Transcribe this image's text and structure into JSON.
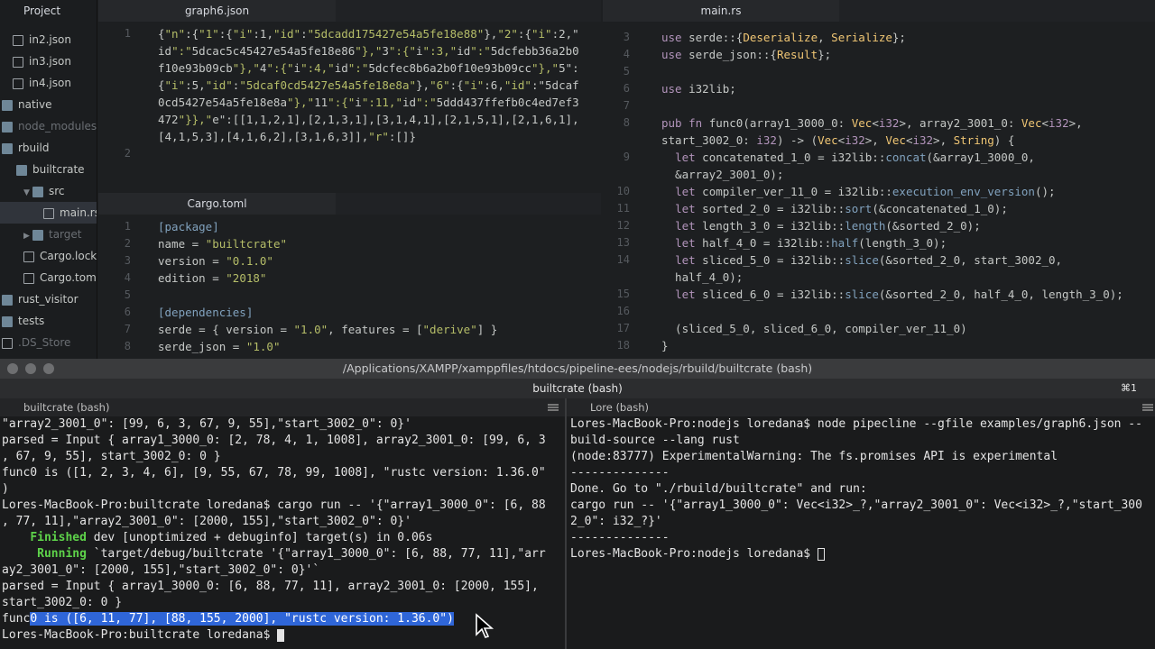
{
  "sidebar": {
    "header": "Project",
    "items": [
      {
        "label": "in2.json",
        "type": "file"
      },
      {
        "label": "in3.json",
        "type": "file"
      },
      {
        "label": "in4.json",
        "type": "file"
      },
      {
        "label": "native",
        "type": "folder"
      },
      {
        "label": "node_modules",
        "type": "folder-dim"
      },
      {
        "label": "rbuild",
        "type": "folder"
      },
      {
        "label": "builtcrate",
        "type": "folder"
      },
      {
        "label": "src",
        "type": "folder-open"
      },
      {
        "label": "main.rs",
        "type": "file-selected"
      },
      {
        "label": "target",
        "type": "folder-dim"
      },
      {
        "label": "Cargo.lock",
        "type": "file"
      },
      {
        "label": "Cargo.toml",
        "type": "file"
      },
      {
        "label": "rust_visitor",
        "type": "folder"
      },
      {
        "label": "tests",
        "type": "folder"
      },
      {
        "label": ".DS_Store",
        "type": "file-dim"
      }
    ]
  },
  "panes": {
    "graph": {
      "tab": "graph6.json",
      "gutter": [
        "1",
        "",
        "",
        "",
        "",
        "",
        "",
        "2"
      ],
      "lines": [
        "{\"n\":{\"1\":{\"i\":1,\"id\":\"5dcadd175427e54a5fe18e88\"},\"2\":{\"i\":2,\"",
        "id\":\"5dcac5c45427e54a5fe18e86\"},\"3\":{\"i\":3,\"id\":\"5dcfebb36a2b0",
        "f10e93b09cb\"},\"4\":{\"i\":4,\"id\":\"5dcfec8b6a2b0f10e93b09cc\"},\"5\":",
        "{\"i\":5,\"id\":\"5dcaf0cd5427e54a5fe18e8a\"},\"6\":{\"i\":6,\"id\":\"5dcaf",
        "0cd5427e54a5fe18e8a\"},\"11\":{\"i\":11,\"id\":\"5ddd437ffefb0c4ed7ef3",
        "472\"}},\"e\":[[1,1,2,1],[2,1,3,1],[3,1,4,1],[2,1,5,1],[2,1,6,1],",
        "[4,1,5,3],[4,1,6,2],[3,1,6,3]],\"r\":[]}",
        ""
      ]
    },
    "cargo": {
      "tab": "Cargo.toml",
      "gutter": [
        "1",
        "2",
        "3",
        "4",
        "5",
        "6",
        "7",
        "8"
      ],
      "lines": [
        "[package]",
        "name = \"builtcrate\"",
        "version = \"0.1.0\"",
        "edition = \"2018\"",
        "",
        "[dependencies]",
        "serde = { version = \"1.0\", features = [\"derive\"] }",
        "serde_json = \"1.0\""
      ]
    },
    "main": {
      "tab": "main.rs",
      "gutter": [
        "3",
        "4",
        "5",
        "6",
        "7",
        "8",
        "",
        "9",
        "",
        "10",
        "11",
        "12",
        "13",
        "14",
        "",
        "15",
        "16",
        "17",
        "18"
      ],
      "lines": [
        "use serde::{Deserialize, Serialize};",
        "use serde_json::{Result};",
        "",
        "use i32lib;",
        "",
        "pub fn func0(array1_3000_0: Vec<i32>, array2_3001_0: Vec<i32>,",
        "start_3002_0: i32) -> (Vec<i32>, Vec<i32>, String) {",
        "  let concatenated_1_0 = i32lib::concat(&array1_3000_0,",
        "  &array2_3001_0);",
        "  let compiler_ver_11_0 = i32lib::execution_env_version();",
        "  let sorted_2_0 = i32lib::sort(&concatenated_1_0);",
        "  let length_3_0 = i32lib::length(&sorted_2_0);",
        "  let half_4_0 = i32lib::half(length_3_0);",
        "  let sliced_5_0 = i32lib::slice(&sorted_2_0, start_3002_0,",
        "  half_4_0);",
        "  let sliced_6_0 = i32lib::slice(&sorted_2_0, half_4_0, length_3_0);",
        "",
        "  (sliced_5_0, sliced_6_0, compiler_ver_11_0)",
        "}"
      ]
    }
  },
  "terminal": {
    "title": "/Applications/XAMPP/xamppfiles/htdocs/pipeline-ees/nodejs/rbuild/builtcrate (bash)",
    "tab_label": "builtcrate (bash)",
    "shortcut": "⌘1",
    "left": {
      "header": "builtcrate (bash)",
      "lines": [
        "\"array2_3001_0\": [99, 6, 3, 67, 9, 55],\"start_3002_0\": 0}'",
        "parsed = Input { array1_3000_0: [2, 78, 4, 1, 1008], array2_3001_0: [99, 6, 3",
        ", 67, 9, 55], start_3002_0: 0 }",
        "func0 is ([1, 2, 3, 4, 6], [9, 55, 67, 78, 99, 1008], \"rustc version: 1.36.0\"",
        ")",
        "Lores-MacBook-Pro:builtcrate loredana$ cargo run -- '{\"array1_3000_0\": [6, 88",
        ", 77, 11],\"array2_3001_0\": [2000, 155],\"start_3002_0\": 0}'",
        "    Finished dev [unoptimized + debuginfo] target(s) in 0.06s",
        "     Running `target/debug/builtcrate '{\"array1_3000_0\": [6, 88, 77, 11],\"arr",
        "ay2_3001_0\": [2000, 155],\"start_3002_0\": 0}'`",
        "parsed = Input { array1_3000_0: [6, 88, 77, 11], array2_3001_0: [2000, 155],",
        "start_3002_0: 0 }",
        "func0 is ([6, 11, 77], [88, 155, 2000], \"rustc version: 1.36.0\")",
        "Lores-MacBook-Pro:builtcrate loredana$ "
      ]
    },
    "right": {
      "header": "Lore (bash)",
      "lines": [
        "Lores-MacBook-Pro:nodejs loredana$ node pipecline --gfile examples/graph6.json --",
        "build-source --lang rust",
        "(node:83777) ExperimentalWarning: The fs.promises API is experimental",
        "--------------",
        "Done. Go to \"./rbuild/builtcrate\" and run:",
        "cargo run -- '{\"array1_3000_0\": Vec<i32>_?,\"array2_3001_0\": Vec<i32>_?,\"start_300",
        "2_0\": i32_?}'",
        "--------------",
        "Lores-MacBook-Pro:nodejs loredana$ "
      ]
    }
  },
  "icons": {
    "file": "file-icon",
    "folder": "folder-icon",
    "cursor": "mouse-pointer-icon"
  },
  "colors": {
    "selection": "#2f66d8",
    "finished_green": "#5ed34a",
    "keyword": "#b294bb",
    "string": "#b5bd68"
  }
}
